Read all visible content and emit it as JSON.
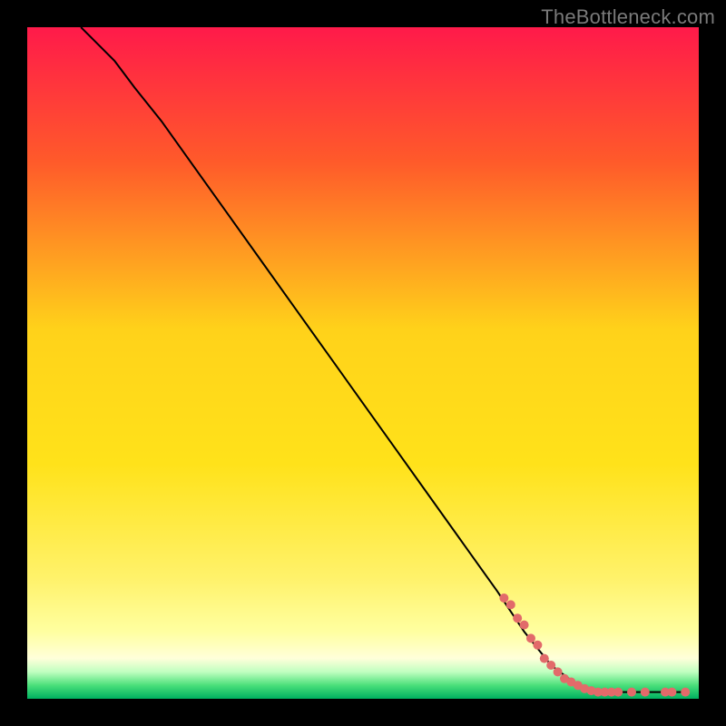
{
  "watermark": "TheBottleneck.com",
  "chart_data": {
    "type": "line",
    "title": "",
    "xlabel": "",
    "ylabel": "",
    "xlim": [
      0,
      100
    ],
    "ylim": [
      0,
      100
    ],
    "background_gradient": {
      "top": "#ff1a4a",
      "mid_upper": "#ff6a2a",
      "mid": "#ffd21a",
      "mid_lower": "#fff26a",
      "lower_band": "#ffffa0",
      "green_start": "#8aff8a",
      "green_end": "#00b060"
    },
    "curve": {
      "name": "bottleneck-curve",
      "color": "#000000",
      "points": [
        {
          "x": 8,
          "y": 100
        },
        {
          "x": 10,
          "y": 98
        },
        {
          "x": 13,
          "y": 95
        },
        {
          "x": 16,
          "y": 91
        },
        {
          "x": 20,
          "y": 86
        },
        {
          "x": 25,
          "y": 79
        },
        {
          "x": 30,
          "y": 72
        },
        {
          "x": 35,
          "y": 65
        },
        {
          "x": 40,
          "y": 58
        },
        {
          "x": 45,
          "y": 51
        },
        {
          "x": 50,
          "y": 44
        },
        {
          "x": 55,
          "y": 37
        },
        {
          "x": 60,
          "y": 30
        },
        {
          "x": 65,
          "y": 23
        },
        {
          "x": 70,
          "y": 16
        },
        {
          "x": 74,
          "y": 10
        },
        {
          "x": 78,
          "y": 5
        },
        {
          "x": 82,
          "y": 2
        },
        {
          "x": 85,
          "y": 1
        },
        {
          "x": 90,
          "y": 1
        },
        {
          "x": 95,
          "y": 1
        },
        {
          "x": 98,
          "y": 1
        }
      ]
    },
    "highlight_points": {
      "name": "highlighted-segment",
      "color": "#e26a6a",
      "radius": 5,
      "points": [
        {
          "x": 71,
          "y": 15
        },
        {
          "x": 72,
          "y": 14
        },
        {
          "x": 73,
          "y": 12
        },
        {
          "x": 74,
          "y": 11
        },
        {
          "x": 75,
          "y": 9
        },
        {
          "x": 76,
          "y": 8
        },
        {
          "x": 77,
          "y": 6
        },
        {
          "x": 78,
          "y": 5
        },
        {
          "x": 79,
          "y": 4
        },
        {
          "x": 80,
          "y": 3
        },
        {
          "x": 81,
          "y": 2.5
        },
        {
          "x": 82,
          "y": 2
        },
        {
          "x": 83,
          "y": 1.5
        },
        {
          "x": 84,
          "y": 1.2
        },
        {
          "x": 85,
          "y": 1
        },
        {
          "x": 86,
          "y": 1
        },
        {
          "x": 87,
          "y": 1
        },
        {
          "x": 88,
          "y": 1
        },
        {
          "x": 90,
          "y": 1
        },
        {
          "x": 92,
          "y": 1
        },
        {
          "x": 95,
          "y": 1
        },
        {
          "x": 96,
          "y": 1
        },
        {
          "x": 98,
          "y": 1
        }
      ]
    }
  }
}
